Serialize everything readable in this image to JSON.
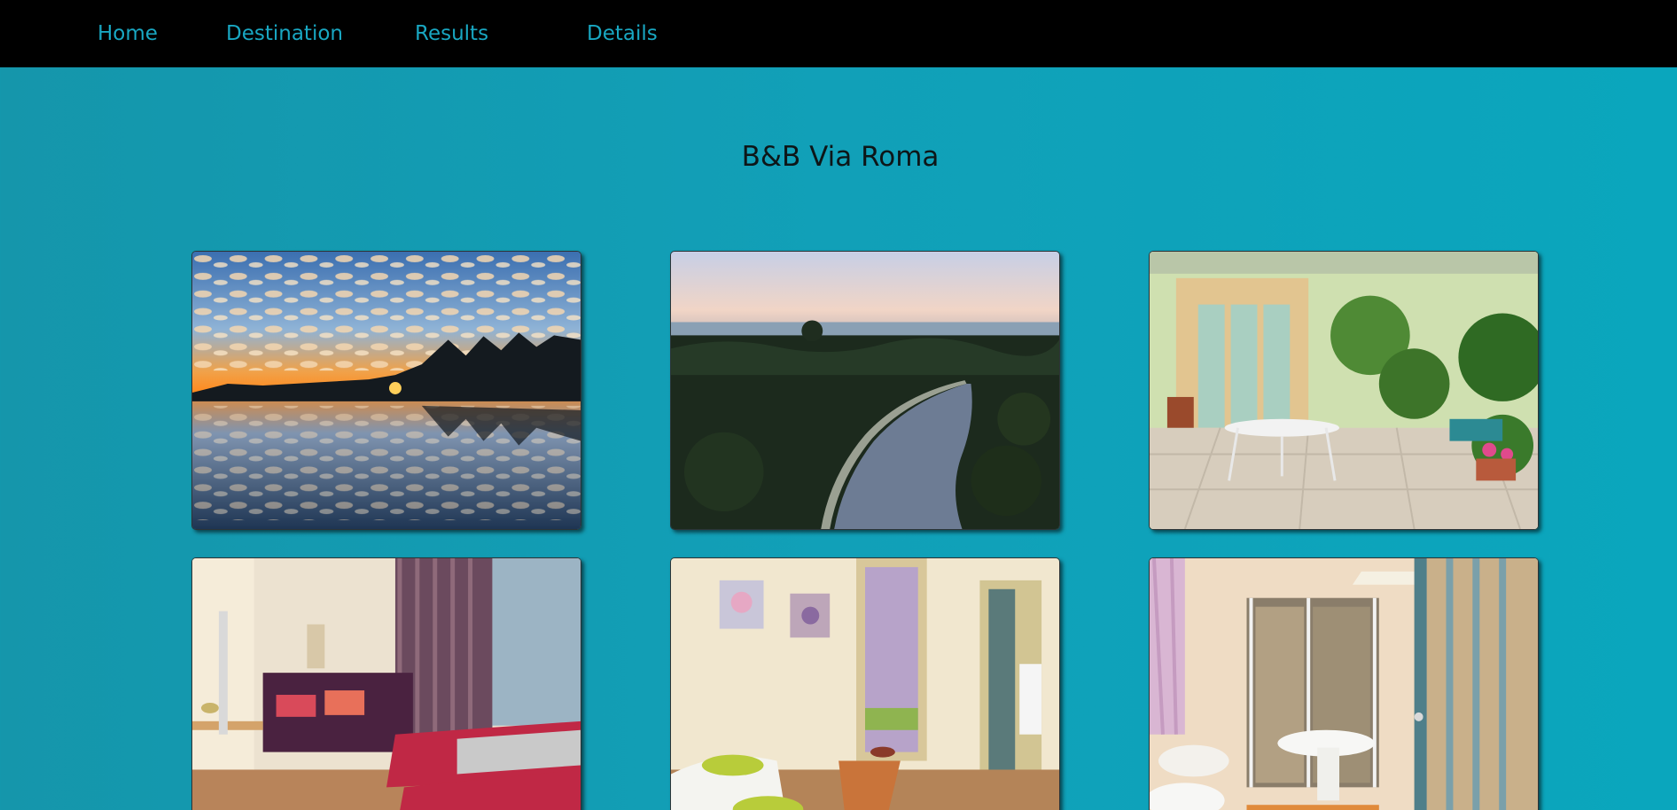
{
  "nav": {
    "items": [
      {
        "label": "Home"
      },
      {
        "label": "Destination"
      },
      {
        "label": "Results"
      },
      {
        "label": "Details"
      }
    ],
    "link_color": "#19a7c2",
    "background": "#000000"
  },
  "page": {
    "title": "B&B Via Roma",
    "background": "#11a0b8"
  },
  "gallery": {
    "photos": [
      {
        "subject": "sunset-lake-reflection"
      },
      {
        "subject": "aerial-canal-forest"
      },
      {
        "subject": "terrace-garden-table"
      },
      {
        "subject": "bedroom-twin-beds-sofa"
      },
      {
        "subject": "room-hallway-armchair"
      },
      {
        "subject": "bathroom-shower-door"
      }
    ]
  }
}
